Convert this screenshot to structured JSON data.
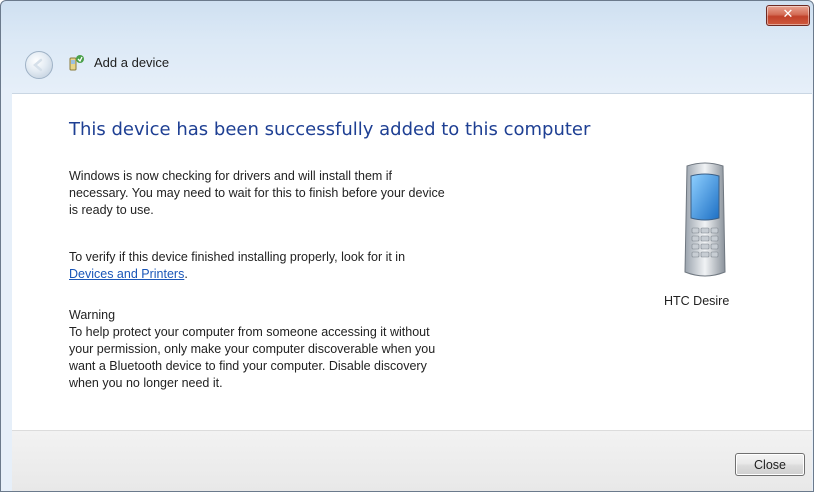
{
  "window": {
    "title": "Add a device",
    "close_glyph": "✕"
  },
  "main": {
    "headline": "This device has been successfully added to this computer",
    "paragraph1": [
      "Windows is now checking for drivers and will install them if",
      "necessary. You may need to wait for this to finish before your device",
      "is ready to use."
    ],
    "paragraph2_line1": "To verify if this device finished installing properly, look for it in",
    "paragraph2_link": "Devices and Printers",
    "paragraph2_suffix": ".",
    "warning_title": "Warning",
    "warning_lines": [
      "To help protect your computer from someone accessing it without",
      "your permission, only make your computer discoverable when you",
      "want a Bluetooth device to find your computer. Disable discovery",
      "when you no longer need it."
    ]
  },
  "device": {
    "name": "HTC Desire",
    "icon": "mobile-phone-icon"
  },
  "footer": {
    "close_label": "Close"
  },
  "icons": {
    "back": "back-arrow-icon",
    "title": "bluetooth-device-icon"
  },
  "colors": {
    "headline": "#1e3f93",
    "link": "#1a56b8",
    "close_x": "#c1412a"
  }
}
